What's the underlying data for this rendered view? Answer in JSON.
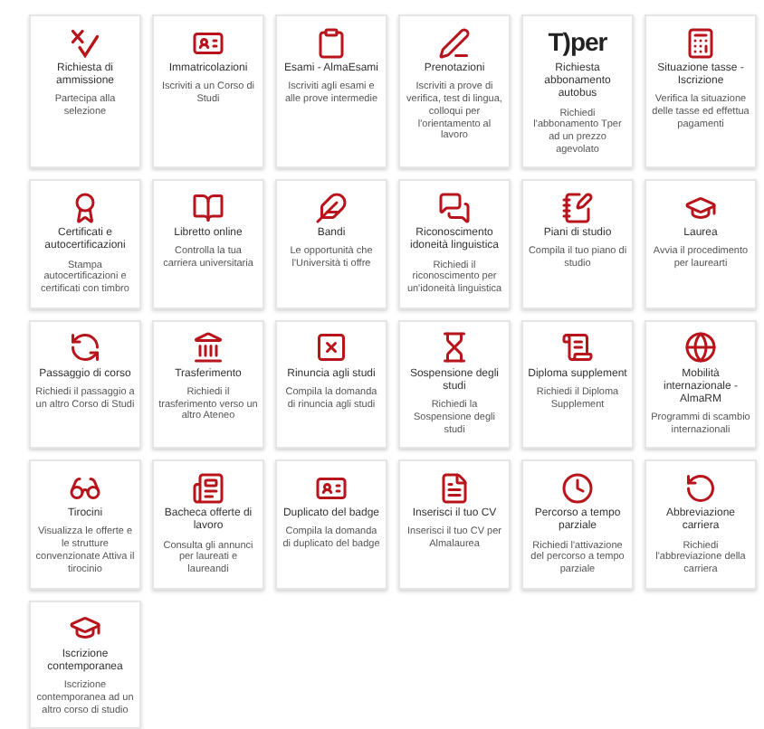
{
  "cards": [
    {
      "title": "Richiesta di ammissione",
      "description": "Partecipa alla selezione"
    },
    {
      "title": "Immatricolazioni",
      "description": "Iscriviti a un Corso di Studi"
    },
    {
      "title": "Esami - AlmaEsami",
      "description": "Iscriviti agli esami e alle prove intermedie"
    },
    {
      "title": "Prenotazioni",
      "description": "Iscriviti a prove di verifica, test di lingua, colloqui per l'orientamento al lavoro"
    },
    {
      "logo": "T)per",
      "title": "Richiesta abbonamento autobus",
      "description": "Richiedi l'abbonamento Tper ad un prezzo agevolato"
    },
    {
      "title": "Situazione tasse - Iscrizione",
      "description": "Verifica la situazione delle tasse ed effettua pagamenti"
    },
    {
      "title": "Certificati e autocertificazioni",
      "description": "Stampa autocertificazioni e certificati con timbro"
    },
    {
      "title": "Libretto online",
      "description": "Controlla la tua carriera universitaria"
    },
    {
      "title": "Bandi",
      "description": "Le opportunità che l'Università ti offre"
    },
    {
      "title": "Riconoscimento idoneità linguistica",
      "description": "Richiedi il riconoscimento per un'idoneità linguistica"
    },
    {
      "title": "Piani di studio",
      "description": "Compila il tuo piano di studio"
    },
    {
      "title": "Laurea",
      "description": "Avvia il procedimento per laurearti"
    },
    {
      "title": "Passaggio di corso",
      "description": "Richiedi il passaggio a un altro Corso di Studi"
    },
    {
      "title": "Trasferimento",
      "description": "Richiedi il trasferimento verso un altro Ateneo"
    },
    {
      "title": "Rinuncia agli studi",
      "description": "Compila la domanda di rinuncia agli studi"
    },
    {
      "title": "Sospensione degli studi",
      "description": "Richiedi la Sospensione degli studi"
    },
    {
      "title": "Diploma supplement",
      "description": "Richiedi il Diploma Supplement"
    },
    {
      "title": "Mobilità internazionale - AlmaRM",
      "description": "Programmi di scambio internazionali"
    },
    {
      "title": "Tirocini",
      "description": "Visualizza le offerte e le strutture convenzionate Attiva il tirocinio"
    },
    {
      "title": "Bacheca offerte di lavoro",
      "description": "Consulta gli annunci per laureati e laureandi"
    },
    {
      "title": "Duplicato del badge",
      "description": "Compila la domanda di duplicato del badge"
    },
    {
      "title": "Inserisci il tuo CV",
      "description": "Inserisci il tuo CV per Almalaurea"
    },
    {
      "title": "Percorso a tempo parziale",
      "description": "Richiedi l'attivazione del percorso a tempo parziale"
    },
    {
      "title": "Abbreviazione carriera",
      "description": "Richiedi l'abbreviazione della carriera"
    },
    {
      "title": "Iscrizione contemporanea",
      "description": "Iscrizione contemporanea ad un altro corso di studio"
    }
  ]
}
